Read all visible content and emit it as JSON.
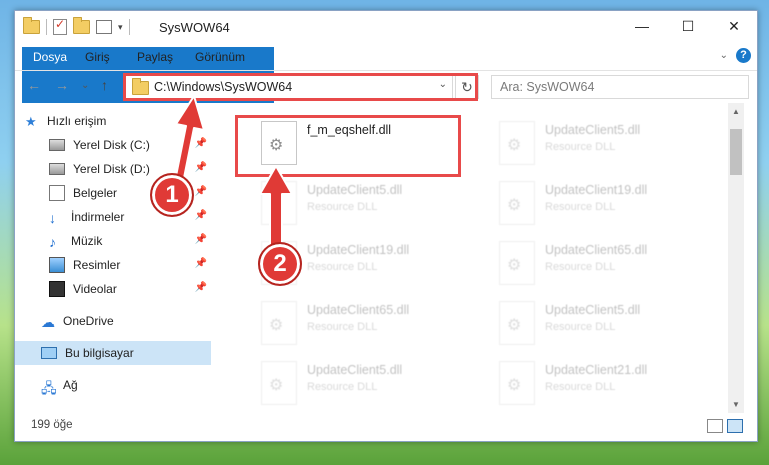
{
  "window": {
    "title": "SysWOW64",
    "controls": {
      "minimize": "—",
      "maximize": "☐",
      "close": "✕"
    }
  },
  "ribbon": {
    "tabs": [
      "Dosya",
      "Giriş",
      "Paylaş",
      "Görünüm"
    ],
    "help": "?",
    "collapse": "⌄"
  },
  "nav": {
    "back": "←",
    "forward": "→",
    "recent": "⌄",
    "up": "↑",
    "address": "C:\\Windows\\SysWOW64",
    "address_dropdown": "⌄",
    "refresh": "↻",
    "search_placeholder": "Ara: SysWOW64"
  },
  "sidebar": {
    "items": [
      {
        "label": "Hızlı erişim",
        "icon": "star-icon"
      },
      {
        "label": "Yerel Disk (C:)",
        "icon": "drive-icon",
        "pinned": true
      },
      {
        "label": "Yerel Disk (D:)",
        "icon": "drive-icon",
        "pinned": true
      },
      {
        "label": "Belgeler",
        "icon": "documents-icon",
        "pinned": true
      },
      {
        "label": "İndirmeler",
        "icon": "download-icon",
        "pinned": true
      },
      {
        "label": "Müzik",
        "icon": "music-icon",
        "pinned": true
      },
      {
        "label": "Resimler",
        "icon": "pictures-icon",
        "pinned": true
      },
      {
        "label": "Videolar",
        "icon": "videos-icon",
        "pinned": true
      },
      {
        "label": "OneDrive",
        "icon": "cloud-icon"
      },
      {
        "label": "Bu bilgisayar",
        "icon": "computer-icon",
        "selected": true
      },
      {
        "label": "Ağ",
        "icon": "network-icon"
      }
    ],
    "pin_glyph": "📌"
  },
  "files": [
    {
      "name": "f_m_eqshelf.dll",
      "desc": ""
    },
    {
      "name": "UpdateClient5.dll",
      "desc": "Resource DLL"
    },
    {
      "name": "UpdateClient5.dll",
      "desc": "Resource DLL"
    },
    {
      "name": "UpdateClient19.dll",
      "desc": "Resource DLL"
    },
    {
      "name": "UpdateClient19.dll",
      "desc": "Resource DLL"
    },
    {
      "name": "UpdateClient65.dll",
      "desc": "Resource DLL"
    },
    {
      "name": "UpdateClient65.dll",
      "desc": "Resource DLL"
    },
    {
      "name": "UpdateClient5.dll",
      "desc": "Resource DLL"
    },
    {
      "name": "UpdateClient5.dll",
      "desc": "Resource DLL"
    },
    {
      "name": "UpdateClient21.dll",
      "desc": "Resource DLL"
    }
  ],
  "status": {
    "count": "199 öğe"
  },
  "callouts": {
    "one": "1",
    "two": "2"
  },
  "colors": {
    "accent": "#1979ca",
    "highlight": "#e84a4a"
  }
}
